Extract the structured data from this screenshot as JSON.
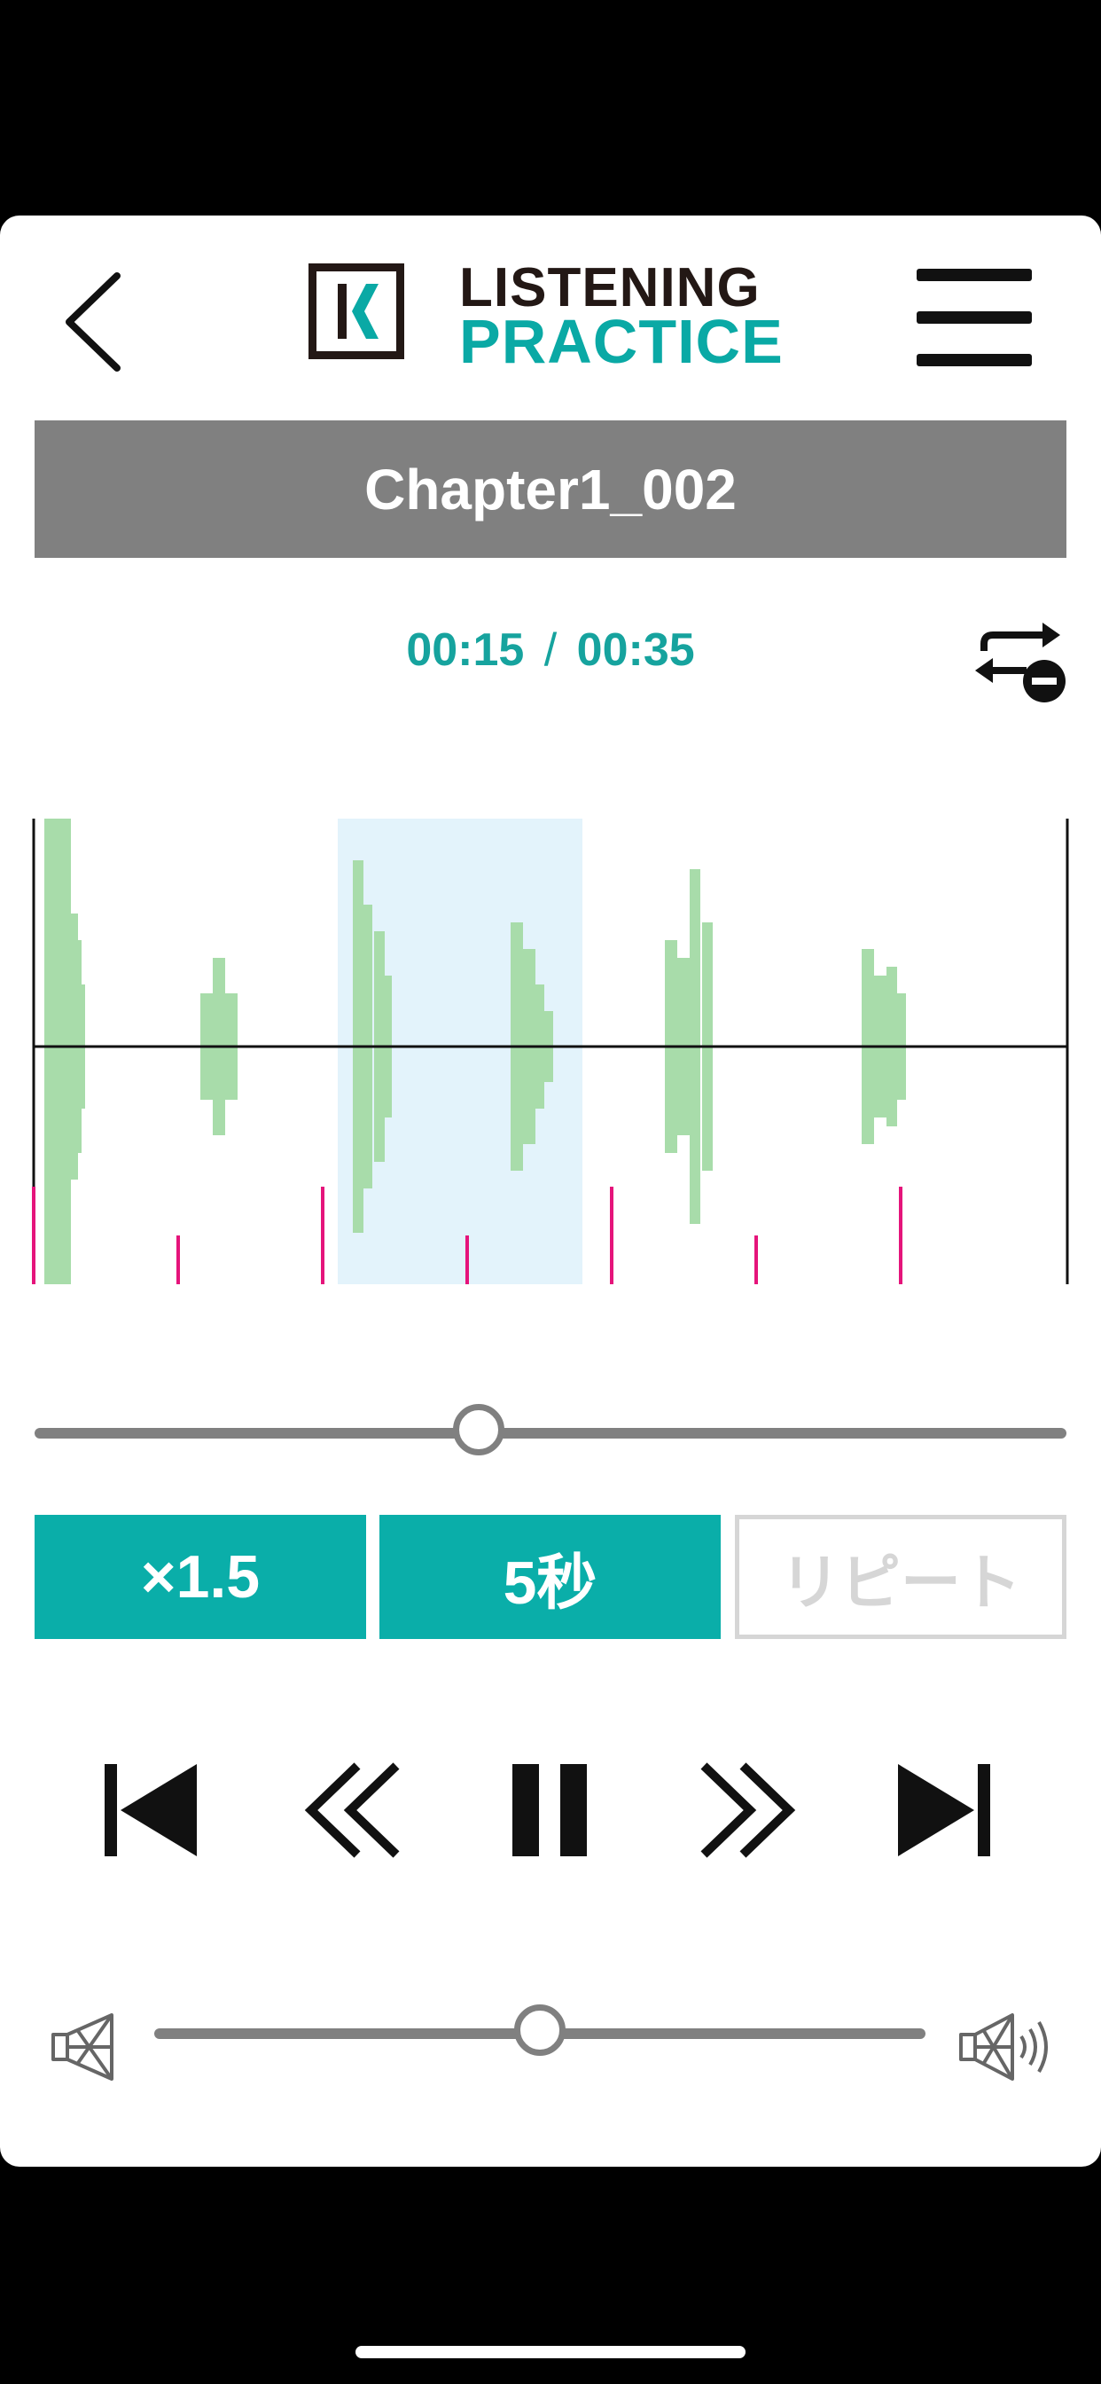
{
  "header": {
    "logo_top": "LISTENING",
    "logo_bottom": "PRACTICE"
  },
  "track": {
    "title": "Chapter1_002",
    "current_time": "00:15",
    "separator": "/",
    "total_time": "00:35",
    "seek_fraction": 0.43
  },
  "controls": {
    "speed_label": "×1.5",
    "skip_label": "5秒",
    "repeat_label": "リピート"
  },
  "volume": {
    "level_fraction": 0.5
  },
  "icons": {
    "back": "chevron-left-icon",
    "menu": "hamburger-menu-icon",
    "repeat_toggle": "repeat-off-icon",
    "prev": "skip-to-start-icon",
    "rewind": "rewind-icon",
    "pause": "pause-icon",
    "forward": "fast-forward-icon",
    "next": "skip-to-end-icon",
    "vol_low": "speaker-mute-icon",
    "vol_high": "speaker-loud-icon"
  },
  "colors": {
    "accent": "#0aaea9",
    "waveform": "#a8dcaa",
    "selection": "#e3f3fb",
    "marker": "#e5147b"
  }
}
